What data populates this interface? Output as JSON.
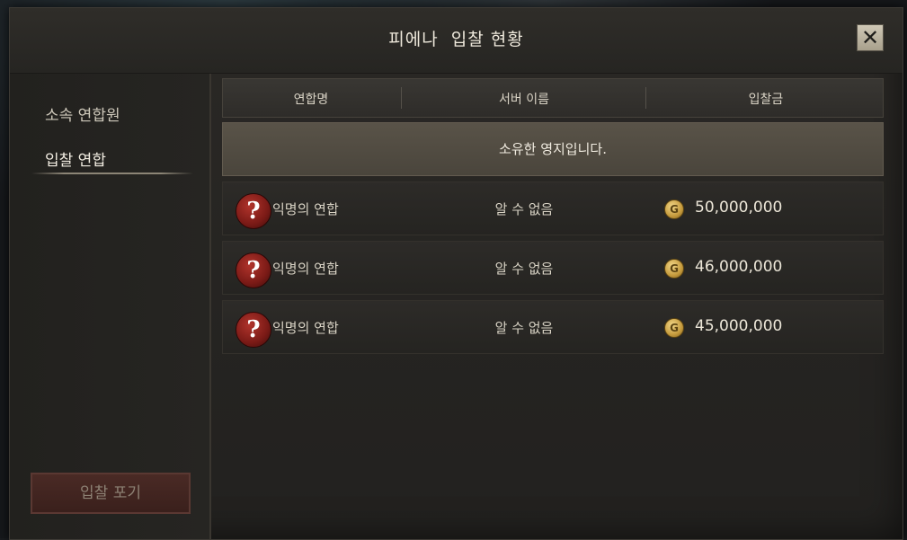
{
  "window": {
    "title": "피에나  입찰 현황",
    "close_label": "✕"
  },
  "sidebar": {
    "items": [
      {
        "label": "소속 연합원",
        "active": false
      },
      {
        "label": "입찰 연합",
        "active": true
      }
    ],
    "giveup_label": "입찰 포기"
  },
  "table": {
    "headers": [
      "연합명",
      "서버 이름",
      "입찰금"
    ],
    "owned_notice": "소유한 영지입니다.",
    "rows": [
      {
        "alliance": "익명의 연합",
        "server": "알 수 없음",
        "bid": "50,000,000"
      },
      {
        "alliance": "익명의 연합",
        "server": "알 수 없음",
        "bid": "46,000,000"
      },
      {
        "alliance": "익명의 연합",
        "server": "알 수 없음",
        "bid": "45,000,000"
      }
    ],
    "unknown_icon": "question-mark-icon",
    "unknown_glyph": "?",
    "currency_icon": "gold-coin-icon",
    "currency_glyph": "G"
  },
  "colors": {
    "accent_gold": "#c59a3c",
    "danger_red": "#7a1a16"
  }
}
